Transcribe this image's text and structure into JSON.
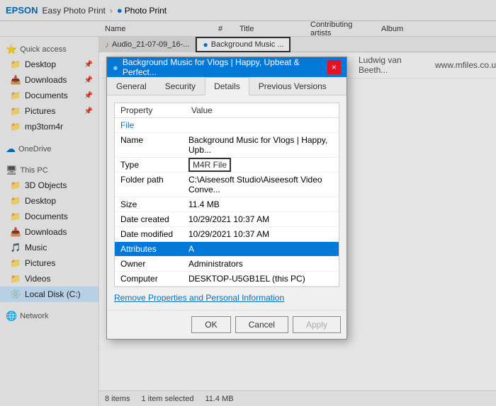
{
  "appBar": {
    "brand": "EPSON",
    "appName": "Easy Photo Print",
    "separator": "»",
    "subApp": "Photo Print"
  },
  "columns": {
    "name": "Name",
    "hash": "#",
    "title": "Title",
    "contributing": "Contributing artists",
    "album": "Album"
  },
  "sidebar": {
    "quickAccess": "Quick access",
    "items": [
      {
        "id": "desktop",
        "label": "Desktop",
        "icon": "folder-blue",
        "pinned": true
      },
      {
        "id": "downloads",
        "label": "Downloads",
        "icon": "folder-dl",
        "pinned": true
      },
      {
        "id": "documents",
        "label": "Documents",
        "icon": "folder-blue",
        "pinned": true
      },
      {
        "id": "pictures",
        "label": "Pictures",
        "icon": "folder-blue",
        "pinned": true
      },
      {
        "id": "mp3tom4r",
        "label": "mp3tom4r",
        "icon": "folder-blue",
        "pinned": false
      }
    ],
    "oneDrive": "OneDrive",
    "thisPC": "This PC",
    "thisPCItems": [
      {
        "id": "3d-objects",
        "label": "3D Objects",
        "icon": "folder-blue"
      },
      {
        "id": "desktop2",
        "label": "Desktop",
        "icon": "folder-blue"
      },
      {
        "id": "documents2",
        "label": "Documents",
        "icon": "folder-blue"
      },
      {
        "id": "downloads2",
        "label": "Downloads",
        "icon": "folder-dl"
      },
      {
        "id": "music",
        "label": "Music",
        "icon": "music"
      },
      {
        "id": "pictures2",
        "label": "Pictures",
        "icon": "folder-blue"
      },
      {
        "id": "videos",
        "label": "Videos",
        "icon": "folder-blue"
      },
      {
        "id": "local-disk",
        "label": "Local Disk (C:)",
        "icon": "disk",
        "selected": true
      }
    ],
    "network": "Network"
  },
  "fileTabs": [
    {
      "id": "tab1",
      "label": "Audio_21-07-09_16-...",
      "active": false
    },
    {
      "id": "tab2",
      "label": "Background Music ...",
      "active": true
    }
  ],
  "fileArea": {
    "contributingArtists": "Ludwig van Beeth...",
    "album": "www.mfiles.co.uk"
  },
  "dialog": {
    "title": "Background Music for Vlogs | Happy, Upbeat & Perfect...",
    "closeBtn": "×",
    "tabs": [
      {
        "id": "general",
        "label": "General"
      },
      {
        "id": "security",
        "label": "Security"
      },
      {
        "id": "details",
        "label": "Details",
        "active": true
      },
      {
        "id": "previous",
        "label": "Previous Versions"
      }
    ],
    "tableHeaders": {
      "property": "Property",
      "value": "Value"
    },
    "section": "File",
    "properties": [
      {
        "key": "Name",
        "value": "Background Music for Vlogs | Happy, Upb...",
        "highlighted": false,
        "hasBox": false
      },
      {
        "key": "Type",
        "value": "M4R File",
        "highlighted": false,
        "hasBox": true
      },
      {
        "key": "Folder path",
        "value": "C:\\Aiseesoft Studio\\Aiseesoft Video Conve...",
        "highlighted": false,
        "hasBox": false
      },
      {
        "key": "Size",
        "value": "11.4 MB",
        "highlighted": false,
        "hasBox": false
      },
      {
        "key": "Date created",
        "value": "10/29/2021 10:37 AM",
        "highlighted": false,
        "hasBox": false
      },
      {
        "key": "Date modified",
        "value": "10/29/2021 10:37 AM",
        "highlighted": false,
        "hasBox": false
      },
      {
        "key": "Attributes",
        "value": "A",
        "highlighted": true,
        "hasBox": false
      },
      {
        "key": "Owner",
        "value": "Administrators",
        "highlighted": false,
        "hasBox": false
      },
      {
        "key": "Computer",
        "value": "DESKTOP-U5GB1EL (this PC)",
        "highlighted": false,
        "hasBox": false
      }
    ],
    "removeLink": "Remove Properties and Personal Information",
    "buttons": {
      "ok": "OK",
      "cancel": "Cancel",
      "apply": "Apply"
    }
  },
  "statusBar": {
    "itemCount": "8 items",
    "selected": "1 item selected",
    "size": "11.4 MB"
  }
}
